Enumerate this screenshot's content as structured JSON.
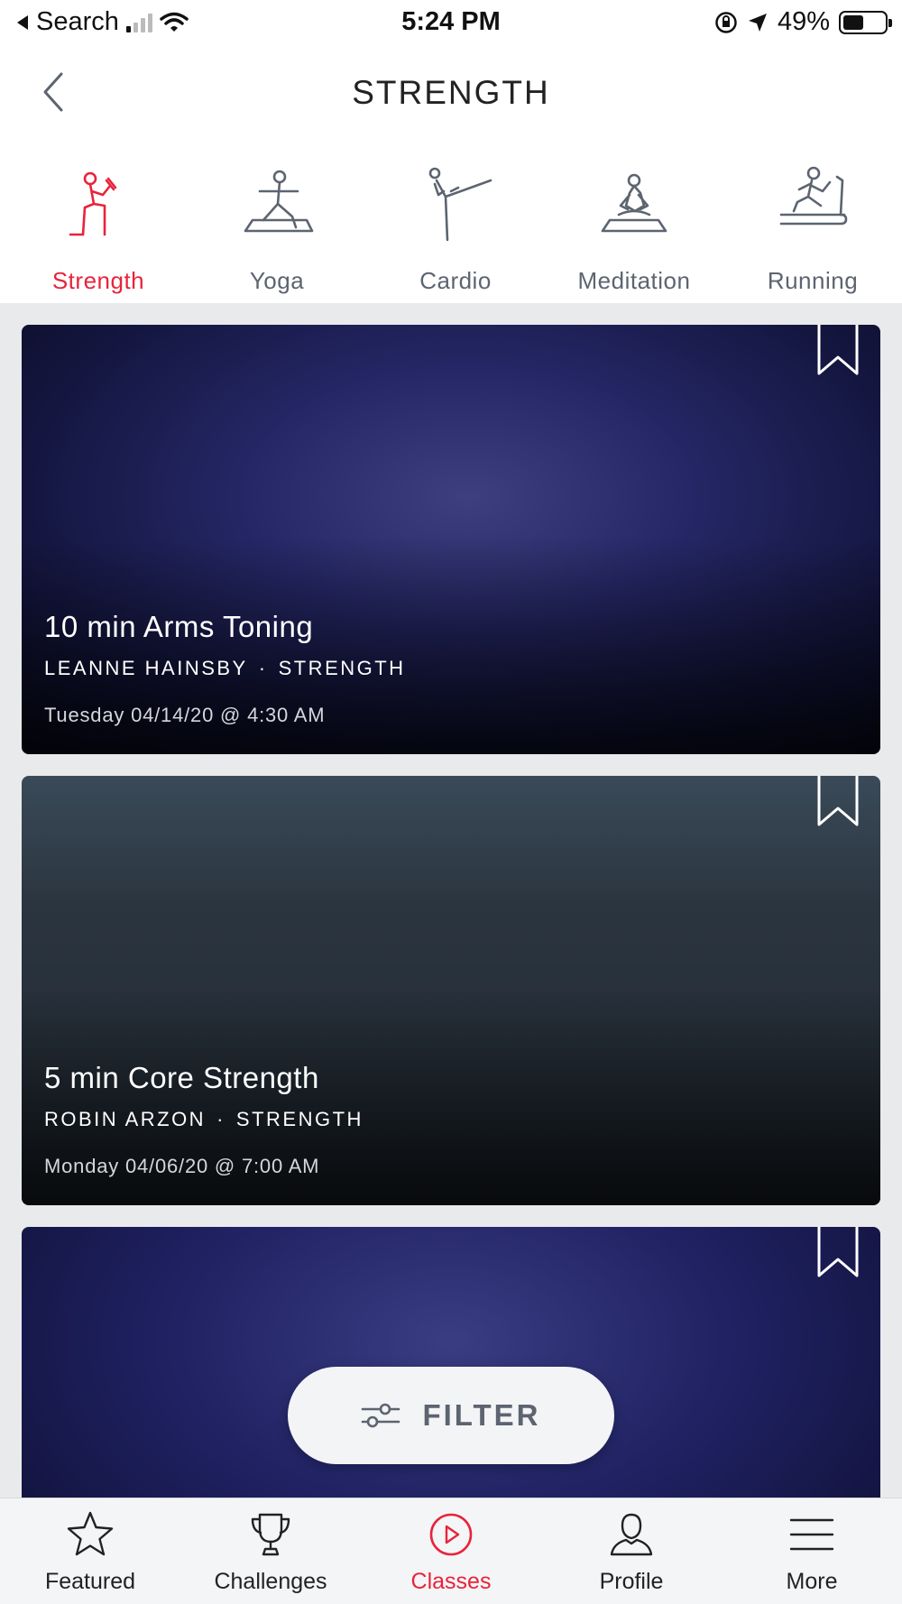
{
  "status_bar": {
    "back_app": "Search",
    "time": "5:24 PM",
    "battery": "49%",
    "battery_level": 0.49
  },
  "header": {
    "title": "STRENGTH"
  },
  "categories": [
    {
      "label": "Strength",
      "icon": "strength-icon",
      "active": true
    },
    {
      "label": "Yoga",
      "icon": "yoga-icon",
      "active": false
    },
    {
      "label": "Cardio",
      "icon": "cardio-icon",
      "active": false
    },
    {
      "label": "Meditation",
      "icon": "meditation-icon",
      "active": false
    },
    {
      "label": "Running",
      "icon": "running-icon",
      "active": false
    }
  ],
  "classes": [
    {
      "title": "10 min Arms Toning",
      "instructor": "LEANNE HAINSBY",
      "category": "STRENGTH",
      "date": "Tuesday 04/14/20 @ 4:30 AM"
    },
    {
      "title": "5 min Core Strength",
      "instructor": "ROBIN ARZON",
      "category": "STRENGTH",
      "date": "Monday 04/06/20 @ 7:00 AM"
    }
  ],
  "filter": {
    "label": "FILTER"
  },
  "tab_bar": [
    {
      "label": "Featured",
      "icon": "star-icon",
      "active": false
    },
    {
      "label": "Challenges",
      "icon": "trophy-icon",
      "active": false
    },
    {
      "label": "Classes",
      "icon": "play-circle-icon",
      "active": true
    },
    {
      "label": "Profile",
      "icon": "profile-icon",
      "active": false
    },
    {
      "label": "More",
      "icon": "menu-icon",
      "active": false
    }
  ],
  "colors": {
    "accent": "#e8233b",
    "inactive": "#5c6470"
  }
}
